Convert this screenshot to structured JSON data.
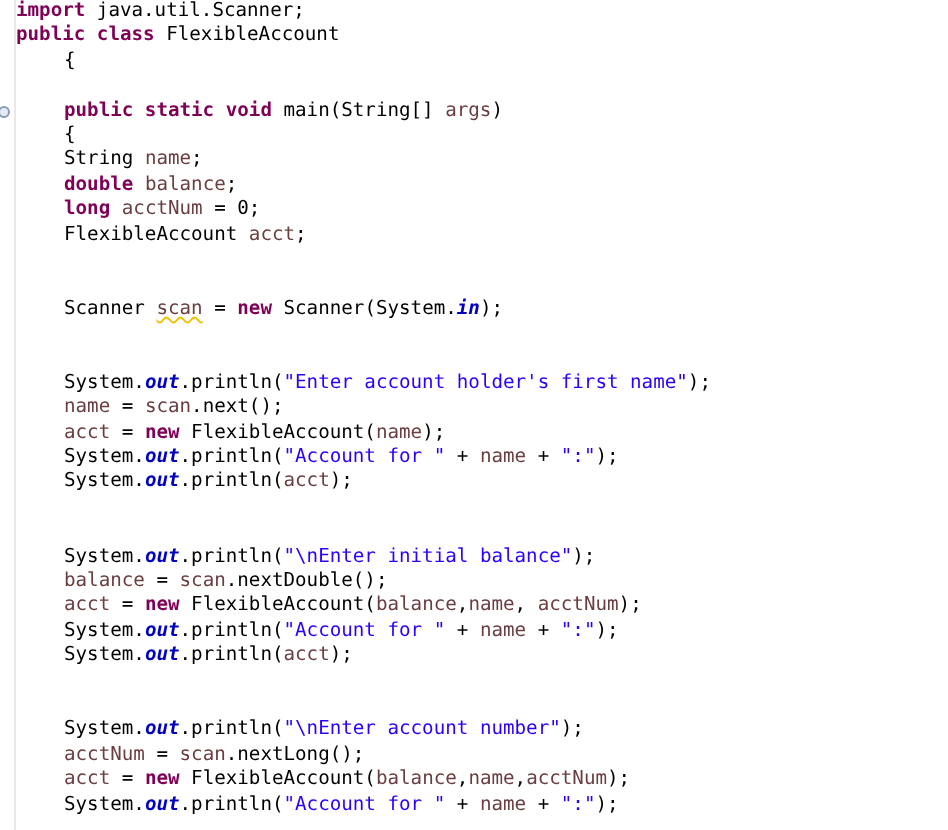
{
  "editor": {
    "lines": [
      {
        "kind": "top",
        "fold_marker": false,
        "tokens": [
          {
            "kind": "keyword",
            "text": "import"
          },
          {
            "kind": "plain",
            "text": " java.util.Scanner;"
          }
        ]
      },
      {
        "kind": "top",
        "fold_marker": false,
        "tokens": [
          {
            "kind": "keyword",
            "text": "public class"
          },
          {
            "kind": "plain",
            "text": " FlexibleAccount"
          }
        ]
      },
      {
        "kind": "body",
        "fold_marker": false,
        "tokens": [
          {
            "kind": "plain",
            "text": "{"
          }
        ]
      },
      {
        "kind": "blank"
      },
      {
        "kind": "body",
        "fold_marker": true,
        "tokens": [
          {
            "kind": "keyword",
            "text": "public static void"
          },
          {
            "kind": "plain",
            "text": " main(String[] "
          },
          {
            "kind": "variable",
            "text": "args"
          },
          {
            "kind": "plain",
            "text": ")"
          }
        ]
      },
      {
        "kind": "body",
        "fold_marker": false,
        "tokens": [
          {
            "kind": "plain",
            "text": "{"
          }
        ]
      },
      {
        "kind": "body",
        "fold_marker": false,
        "tokens": [
          {
            "kind": "plain",
            "text": "String "
          },
          {
            "kind": "variable",
            "text": "name"
          },
          {
            "kind": "plain",
            "text": ";"
          }
        ]
      },
      {
        "kind": "body",
        "fold_marker": false,
        "tokens": [
          {
            "kind": "keyword",
            "text": "double "
          },
          {
            "kind": "variable",
            "text": "balance"
          },
          {
            "kind": "plain",
            "text": ";"
          }
        ]
      },
      {
        "kind": "body",
        "fold_marker": false,
        "tokens": [
          {
            "kind": "keyword",
            "text": "long "
          },
          {
            "kind": "variable",
            "text": "acctNum"
          },
          {
            "kind": "plain",
            "text": " = 0;"
          }
        ]
      },
      {
        "kind": "body",
        "fold_marker": false,
        "tokens": [
          {
            "kind": "plain",
            "text": "FlexibleAccount "
          },
          {
            "kind": "variable",
            "text": "acct"
          },
          {
            "kind": "plain",
            "text": ";"
          }
        ]
      },
      {
        "kind": "blank"
      },
      {
        "kind": "blank"
      },
      {
        "kind": "body",
        "fold_marker": false,
        "tokens": [
          {
            "kind": "plain",
            "text": "Scanner "
          },
          {
            "kind": "warning",
            "text": "scan"
          },
          {
            "kind": "plain",
            "text": " = "
          },
          {
            "kind": "keyword",
            "text": "new"
          },
          {
            "kind": "plain",
            "text": " Scanner(System."
          },
          {
            "kind": "field",
            "text": "in"
          },
          {
            "kind": "plain",
            "text": ");"
          }
        ]
      },
      {
        "kind": "blank"
      },
      {
        "kind": "blank"
      },
      {
        "kind": "body",
        "fold_marker": false,
        "tokens": [
          {
            "kind": "plain",
            "text": "System."
          },
          {
            "kind": "field",
            "text": "out"
          },
          {
            "kind": "plain",
            "text": ".println("
          },
          {
            "kind": "string",
            "text": "\"Enter account holder's first name\""
          },
          {
            "kind": "plain",
            "text": ");"
          }
        ]
      },
      {
        "kind": "body",
        "fold_marker": false,
        "tokens": [
          {
            "kind": "variable",
            "text": "name"
          },
          {
            "kind": "plain",
            "text": " = "
          },
          {
            "kind": "variable",
            "text": "scan"
          },
          {
            "kind": "plain",
            "text": ".next();"
          }
        ]
      },
      {
        "kind": "body",
        "fold_marker": false,
        "tokens": [
          {
            "kind": "variable",
            "text": "acct"
          },
          {
            "kind": "plain",
            "text": " = "
          },
          {
            "kind": "keyword",
            "text": "new"
          },
          {
            "kind": "plain",
            "text": " FlexibleAccount("
          },
          {
            "kind": "variable",
            "text": "name"
          },
          {
            "kind": "plain",
            "text": ");"
          }
        ]
      },
      {
        "kind": "body",
        "fold_marker": false,
        "tokens": [
          {
            "kind": "plain",
            "text": "System."
          },
          {
            "kind": "field",
            "text": "out"
          },
          {
            "kind": "plain",
            "text": ".println("
          },
          {
            "kind": "string",
            "text": "\"Account for \""
          },
          {
            "kind": "plain",
            "text": " + "
          },
          {
            "kind": "variable",
            "text": "name"
          },
          {
            "kind": "plain",
            "text": " + "
          },
          {
            "kind": "string",
            "text": "\":\""
          },
          {
            "kind": "plain",
            "text": ");"
          }
        ]
      },
      {
        "kind": "body",
        "fold_marker": false,
        "tokens": [
          {
            "kind": "plain",
            "text": "System."
          },
          {
            "kind": "field",
            "text": "out"
          },
          {
            "kind": "plain",
            "text": ".println("
          },
          {
            "kind": "variable",
            "text": "acct"
          },
          {
            "kind": "plain",
            "text": ");"
          }
        ]
      },
      {
        "kind": "blank"
      },
      {
        "kind": "blank"
      },
      {
        "kind": "body",
        "fold_marker": false,
        "tokens": [
          {
            "kind": "plain",
            "text": "System."
          },
          {
            "kind": "field",
            "text": "out"
          },
          {
            "kind": "plain",
            "text": ".println("
          },
          {
            "kind": "string",
            "text": "\"\\nEnter initial balance\""
          },
          {
            "kind": "plain",
            "text": ");"
          }
        ]
      },
      {
        "kind": "body",
        "fold_marker": false,
        "tokens": [
          {
            "kind": "variable",
            "text": "balance"
          },
          {
            "kind": "plain",
            "text": " = "
          },
          {
            "kind": "variable",
            "text": "scan"
          },
          {
            "kind": "plain",
            "text": ".nextDouble();"
          }
        ]
      },
      {
        "kind": "body",
        "fold_marker": false,
        "tokens": [
          {
            "kind": "variable",
            "text": "acct"
          },
          {
            "kind": "plain",
            "text": " = "
          },
          {
            "kind": "keyword",
            "text": "new"
          },
          {
            "kind": "plain",
            "text": " FlexibleAccount("
          },
          {
            "kind": "variable",
            "text": "balance"
          },
          {
            "kind": "plain",
            "text": ","
          },
          {
            "kind": "variable",
            "text": "name"
          },
          {
            "kind": "plain",
            "text": ", "
          },
          {
            "kind": "variable",
            "text": "acctNum"
          },
          {
            "kind": "plain",
            "text": ");"
          }
        ]
      },
      {
        "kind": "body",
        "fold_marker": false,
        "tokens": [
          {
            "kind": "plain",
            "text": "System."
          },
          {
            "kind": "field",
            "text": "out"
          },
          {
            "kind": "plain",
            "text": ".println("
          },
          {
            "kind": "string",
            "text": "\"Account for \""
          },
          {
            "kind": "plain",
            "text": " + "
          },
          {
            "kind": "variable",
            "text": "name"
          },
          {
            "kind": "plain",
            "text": " + "
          },
          {
            "kind": "string",
            "text": "\":\""
          },
          {
            "kind": "plain",
            "text": ");"
          }
        ]
      },
      {
        "kind": "body",
        "fold_marker": false,
        "tokens": [
          {
            "kind": "plain",
            "text": "System."
          },
          {
            "kind": "field",
            "text": "out"
          },
          {
            "kind": "plain",
            "text": ".println("
          },
          {
            "kind": "variable",
            "text": "acct"
          },
          {
            "kind": "plain",
            "text": ");"
          }
        ]
      },
      {
        "kind": "blank"
      },
      {
        "kind": "blank"
      },
      {
        "kind": "body",
        "fold_marker": false,
        "tokens": [
          {
            "kind": "plain",
            "text": "System."
          },
          {
            "kind": "field",
            "text": "out"
          },
          {
            "kind": "plain",
            "text": ".println("
          },
          {
            "kind": "string",
            "text": "\"\\nEnter account number\""
          },
          {
            "kind": "plain",
            "text": ");"
          }
        ]
      },
      {
        "kind": "body",
        "fold_marker": false,
        "tokens": [
          {
            "kind": "variable",
            "text": "acctNum"
          },
          {
            "kind": "plain",
            "text": " = "
          },
          {
            "kind": "variable",
            "text": "scan"
          },
          {
            "kind": "plain",
            "text": ".nextLong();"
          }
        ]
      },
      {
        "kind": "body",
        "fold_marker": false,
        "tokens": [
          {
            "kind": "variable",
            "text": "acct"
          },
          {
            "kind": "plain",
            "text": " = "
          },
          {
            "kind": "keyword",
            "text": "new"
          },
          {
            "kind": "plain",
            "text": " FlexibleAccount("
          },
          {
            "kind": "variable",
            "text": "balance"
          },
          {
            "kind": "plain",
            "text": ","
          },
          {
            "kind": "variable",
            "text": "name"
          },
          {
            "kind": "plain",
            "text": ","
          },
          {
            "kind": "variable",
            "text": "acctNum"
          },
          {
            "kind": "plain",
            "text": ");"
          }
        ]
      },
      {
        "kind": "body",
        "fold_marker": false,
        "tokens": [
          {
            "kind": "plain",
            "text": "System."
          },
          {
            "kind": "field",
            "text": "out"
          },
          {
            "kind": "plain",
            "text": ".println("
          },
          {
            "kind": "string",
            "text": "\"Account for \""
          },
          {
            "kind": "plain",
            "text": " + "
          },
          {
            "kind": "variable",
            "text": "name"
          },
          {
            "kind": "plain",
            "text": " + "
          },
          {
            "kind": "string",
            "text": "\":\""
          },
          {
            "kind": "plain",
            "text": ");"
          }
        ]
      }
    ]
  }
}
